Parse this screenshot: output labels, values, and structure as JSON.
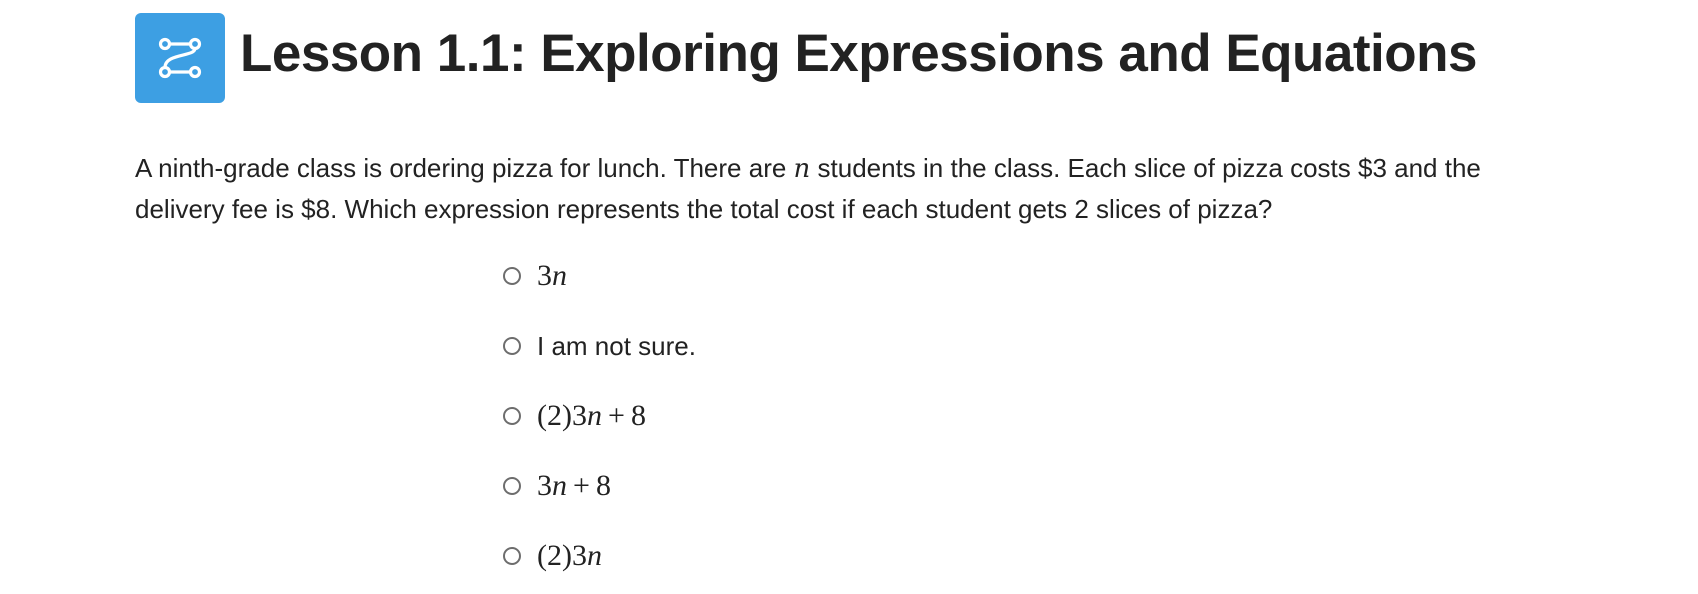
{
  "header": {
    "icon": "path-nodes-icon",
    "icon_color": "#3d9fe3",
    "title": "Lesson 1.1: Exploring Expressions and Equations"
  },
  "question": {
    "text_part1": "A ninth-grade class is ordering pizza for lunch. There are ",
    "variable": "n",
    "text_part2": " students in the class. Each slice of pizza costs $3 and the delivery fee is $8. Which expression represents the total cost if each student gets 2 slices of pizza?"
  },
  "options": [
    {
      "label": "3n",
      "kind": "math",
      "selected": false
    },
    {
      "label": "I am not sure.",
      "kind": "text",
      "selected": false
    },
    {
      "label": "(2)3n + 8",
      "kind": "math",
      "selected": false
    },
    {
      "label": "3n + 8",
      "kind": "math",
      "selected": false
    },
    {
      "label": "(2)3n",
      "kind": "math",
      "selected": false
    }
  ]
}
